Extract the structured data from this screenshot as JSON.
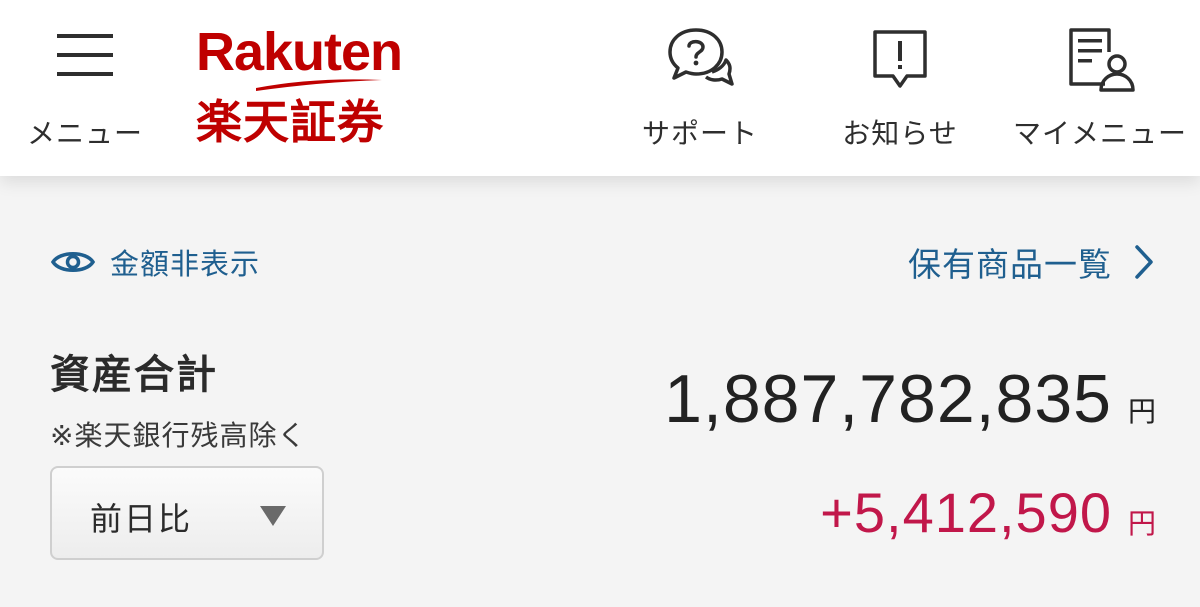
{
  "header": {
    "menu_label": "メニュー",
    "brand": {
      "wordmark": "Rakuten",
      "name": "楽天証券",
      "color": "#bf0000"
    },
    "support_label": "サポート",
    "notice_label": "お知らせ",
    "mymenu_label": "マイメニュー",
    "icons": {
      "menu": "hamburger-icon",
      "support": "question-chat-icon",
      "notice": "exclamation-bubble-icon",
      "mymenu": "document-user-icon"
    }
  },
  "summary": {
    "hide_amount_label": "金額非表示",
    "hide_icon": "eye-icon",
    "holdings_link_label": "保有商品一覧",
    "asset_title": "資産合計",
    "asset_note": "※楽天銀行残高除く",
    "compare_select_value": "前日比",
    "total_amount": "1,887,782,835",
    "total_unit": "円",
    "change_amount": "+5,412,590",
    "change_unit": "円",
    "link_color": "#1f5f8f",
    "gain_color": "#c1174a"
  }
}
